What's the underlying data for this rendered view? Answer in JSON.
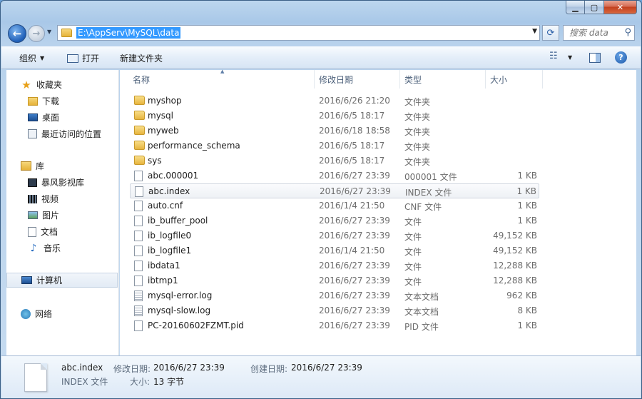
{
  "address": {
    "path": "E:\\AppServ\\MySQL\\data",
    "search_placeholder": "搜索 data"
  },
  "toolbar": {
    "organize_label": "组织",
    "open_label": "打开",
    "new_folder_label": "新建文件夹"
  },
  "sidebar": {
    "favorites": {
      "header": "收藏夹",
      "items": [
        {
          "label": "下载",
          "icon": "download-folder-icon"
        },
        {
          "label": "桌面",
          "icon": "desktop-icon"
        },
        {
          "label": "最近访问的位置",
          "icon": "recent-places-icon"
        }
      ]
    },
    "libraries": {
      "header": "库",
      "items": [
        {
          "label": "暴风影视库",
          "icon": "video-library-icon"
        },
        {
          "label": "视频",
          "icon": "videos-icon"
        },
        {
          "label": "图片",
          "icon": "pictures-icon"
        },
        {
          "label": "文档",
          "icon": "documents-icon"
        },
        {
          "label": "音乐",
          "icon": "music-icon"
        }
      ]
    },
    "computer": {
      "label": "计算机"
    },
    "network": {
      "label": "网络"
    }
  },
  "columns": {
    "name": "名称",
    "date": "修改日期",
    "type": "类型",
    "size": "大小"
  },
  "files": [
    {
      "name": "myshop",
      "date": "2016/6/26 21:20",
      "type": "文件夹",
      "size": "",
      "kind": "folder"
    },
    {
      "name": "mysql",
      "date": "2016/6/5 18:17",
      "type": "文件夹",
      "size": "",
      "kind": "folder"
    },
    {
      "name": "myweb",
      "date": "2016/6/18 18:58",
      "type": "文件夹",
      "size": "",
      "kind": "folder"
    },
    {
      "name": "performance_schema",
      "date": "2016/6/5 18:17",
      "type": "文件夹",
      "size": "",
      "kind": "folder"
    },
    {
      "name": "sys",
      "date": "2016/6/5 18:17",
      "type": "文件夹",
      "size": "",
      "kind": "folder"
    },
    {
      "name": "abc.000001",
      "date": "2016/6/27 23:39",
      "type": "000001 文件",
      "size": "1 KB",
      "kind": "file"
    },
    {
      "name": "abc.index",
      "date": "2016/6/27 23:39",
      "type": "INDEX 文件",
      "size": "1 KB",
      "kind": "file"
    },
    {
      "name": "auto.cnf",
      "date": "2016/1/4 21:50",
      "type": "CNF 文件",
      "size": "1 KB",
      "kind": "file"
    },
    {
      "name": "ib_buffer_pool",
      "date": "2016/6/27 23:39",
      "type": "文件",
      "size": "1 KB",
      "kind": "file"
    },
    {
      "name": "ib_logfile0",
      "date": "2016/6/27 23:39",
      "type": "文件",
      "size": "49,152 KB",
      "kind": "file"
    },
    {
      "name": "ib_logfile1",
      "date": "2016/1/4 21:50",
      "type": "文件",
      "size": "49,152 KB",
      "kind": "file"
    },
    {
      "name": "ibdata1",
      "date": "2016/6/27 23:39",
      "type": "文件",
      "size": "12,288 KB",
      "kind": "file"
    },
    {
      "name": "ibtmp1",
      "date": "2016/6/27 23:39",
      "type": "文件",
      "size": "12,288 KB",
      "kind": "file"
    },
    {
      "name": "mysql-error.log",
      "date": "2016/6/27 23:39",
      "type": "文本文档",
      "size": "962 KB",
      "kind": "text"
    },
    {
      "name": "mysql-slow.log",
      "date": "2016/6/27 23:39",
      "type": "文本文档",
      "size": "8 KB",
      "kind": "text"
    },
    {
      "name": "PC-20160602FZMT.pid",
      "date": "2016/6/27 23:39",
      "type": "PID 文件",
      "size": "1 KB",
      "kind": "file"
    }
  ],
  "selected_index": 6,
  "details": {
    "name": "abc.index",
    "modified_label": "修改日期:",
    "modified": "2016/6/27 23:39",
    "created_label": "创建日期:",
    "created": "2016/6/27 23:39",
    "type": "INDEX 文件",
    "size_label": "大小:",
    "size": "13 字节"
  }
}
